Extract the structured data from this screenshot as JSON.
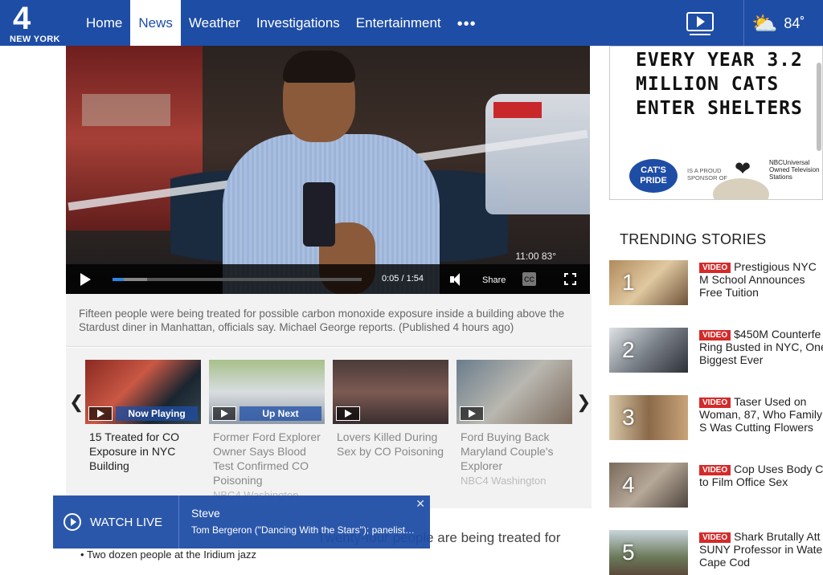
{
  "header": {
    "logo_number": "4",
    "logo_city": "NEW YORK",
    "nav": [
      {
        "label": "Home"
      },
      {
        "label": "News"
      },
      {
        "label": "Weather"
      },
      {
        "label": "Investigations"
      },
      {
        "label": "Entertainment"
      }
    ],
    "more_label": "•••",
    "temperature": "84˚"
  },
  "player": {
    "time_current": "0:05",
    "time_separator": "/",
    "time_total": "1:54",
    "progress_fraction": 0.045,
    "buffered_fraction": 0.14,
    "share_label": "Share",
    "cc_label": "CC",
    "bug_text": "11:00   83°"
  },
  "caption": "Fifteen people were being treated for possible carbon monoxide exposure inside a building above the Stardust diner in Manhattan, officials say. Michael George reports. (Published 4 hours ago)",
  "carousel": {
    "prev_label": "❮",
    "next_label": "❯",
    "items": [
      {
        "title": "15 Treated for CO Exposure in NYC Building",
        "badge": "Now Playing",
        "source": ""
      },
      {
        "title": "Former Ford Explorer Owner Says Blood Test Confirmed CO Poisoning",
        "badge": "Up Next",
        "source": "NBC4 Washington"
      },
      {
        "title": "Lovers Killed During Sex by CO Poisoning",
        "badge": "",
        "source": ""
      },
      {
        "title": "Ford Buying Back Maryland Couple's Explorer",
        "badge": "",
        "source": "NBC4 Washington"
      }
    ]
  },
  "watch_live": {
    "label": "WATCH LIVE",
    "show": "Steve",
    "description": "Tom Bergeron (\"Dancing With the Stars\"); panelists...",
    "close": "✕"
  },
  "article": {
    "lead": "Twenty-four people are being treated for",
    "bullet": "Two dozen people at the Iridium jazz"
  },
  "ad": {
    "headline": "EVERY YEAR 3.2\nMILLION CATS\nENTER SHELTERS",
    "brand": "CAT'S PRIDE",
    "sponsor_text": "IS A PROUD SPONSOR OF",
    "partner": "NBCUniversal Owned Television Stations"
  },
  "trending": {
    "title": "TRENDING STORIES",
    "badge": "VIDEO",
    "items": [
      {
        "rank": "1",
        "text": "Prestigious NYC M School Announces Free Tuition"
      },
      {
        "rank": "2",
        "text": "$450M Counterfe Ring Busted in NYC, One Biggest Ever"
      },
      {
        "rank": "3",
        "text": "Taser Used on Woman, 87, Who Family S Was Cutting Flowers"
      },
      {
        "rank": "4",
        "text": "Cop Uses Body C to Film Office Sex"
      },
      {
        "rank": "5",
        "text": "Shark Brutally Att SUNY Professor in Wate Cape Cod"
      }
    ]
  },
  "colors": {
    "brand_blue": "#1e4da6",
    "video_red": "#d52a2a",
    "progress_blue": "#2b86e6"
  }
}
